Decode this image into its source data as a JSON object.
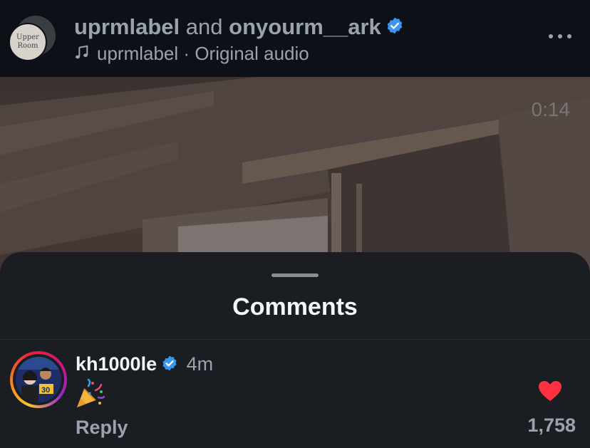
{
  "post": {
    "avatar_text_line1": "Upper",
    "avatar_text_line2": "Room",
    "author": "uprmlabel",
    "joiner": "and",
    "collaborator": "onyourm__ark",
    "audio_author": "uprmlabel",
    "audio_separator": "·",
    "audio_title": "Original audio",
    "icons": {
      "verified": "verified-badge-icon",
      "music": "music-note-icon",
      "more": "more-options-icon"
    }
  },
  "video": {
    "elapsed": "0:14"
  },
  "comments_sheet": {
    "title": "Comments",
    "comments": [
      {
        "username": "kh1000le",
        "verified": true,
        "time_ago": "4m",
        "text_emoji": "party-popper-icon",
        "reply_label": "Reply",
        "liked": true,
        "like_count": "1,758"
      }
    ]
  },
  "colors": {
    "verified_blue": "#3897f0",
    "heart_red": "#ff3040",
    "header_bg": "#0d1117",
    "sheet_bg": "#1a1d22",
    "muted_text": "#9aa3ad"
  }
}
